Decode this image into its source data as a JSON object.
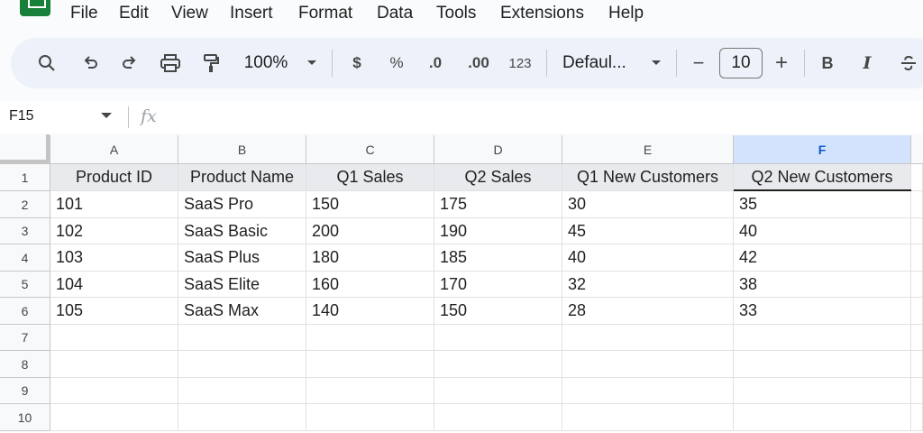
{
  "menu": [
    "File",
    "Edit",
    "View",
    "Insert",
    "Format",
    "Data",
    "Tools",
    "Extensions",
    "Help"
  ],
  "toolbar": {
    "zoom": "100%",
    "currency": "$",
    "percent": "%",
    "decrease_decimal": ".0",
    "increase_decimal": ".00",
    "number_format": "123",
    "font": "Defaul...",
    "font_size": "10",
    "minus": "−",
    "plus": "+",
    "bold": "B",
    "italic": "I"
  },
  "formula_bar": {
    "cell_ref": "F15",
    "fx": "fx"
  },
  "grid": {
    "columns": [
      "A",
      "B",
      "C",
      "D",
      "E",
      "F"
    ],
    "selected_column": "F",
    "row_numbers": [
      "1",
      "2",
      "3",
      "4",
      "5",
      "6",
      "7",
      "8",
      "9",
      "10"
    ],
    "header_row": [
      "Product ID",
      "Product Name",
      "Q1 Sales",
      "Q2 Sales",
      "Q1 New Customers",
      "Q2 New Customers"
    ],
    "rows": [
      [
        "101",
        "SaaS Pro",
        "150",
        "175",
        "30",
        "35"
      ],
      [
        "102",
        "SaaS Basic",
        "200",
        "190",
        "45",
        "40"
      ],
      [
        "103",
        "SaaS Plus",
        "180",
        "185",
        "40",
        "42"
      ],
      [
        "104",
        "SaaS Elite",
        "160",
        "170",
        "32",
        "38"
      ],
      [
        "105",
        "SaaS Max",
        "140",
        "150",
        "28",
        "33"
      ]
    ]
  },
  "colors": {
    "accent": "#0b57d0",
    "selected_header": "#d3e3fd",
    "toolbar_bg": "#edf2fa",
    "logo": "#188038"
  }
}
